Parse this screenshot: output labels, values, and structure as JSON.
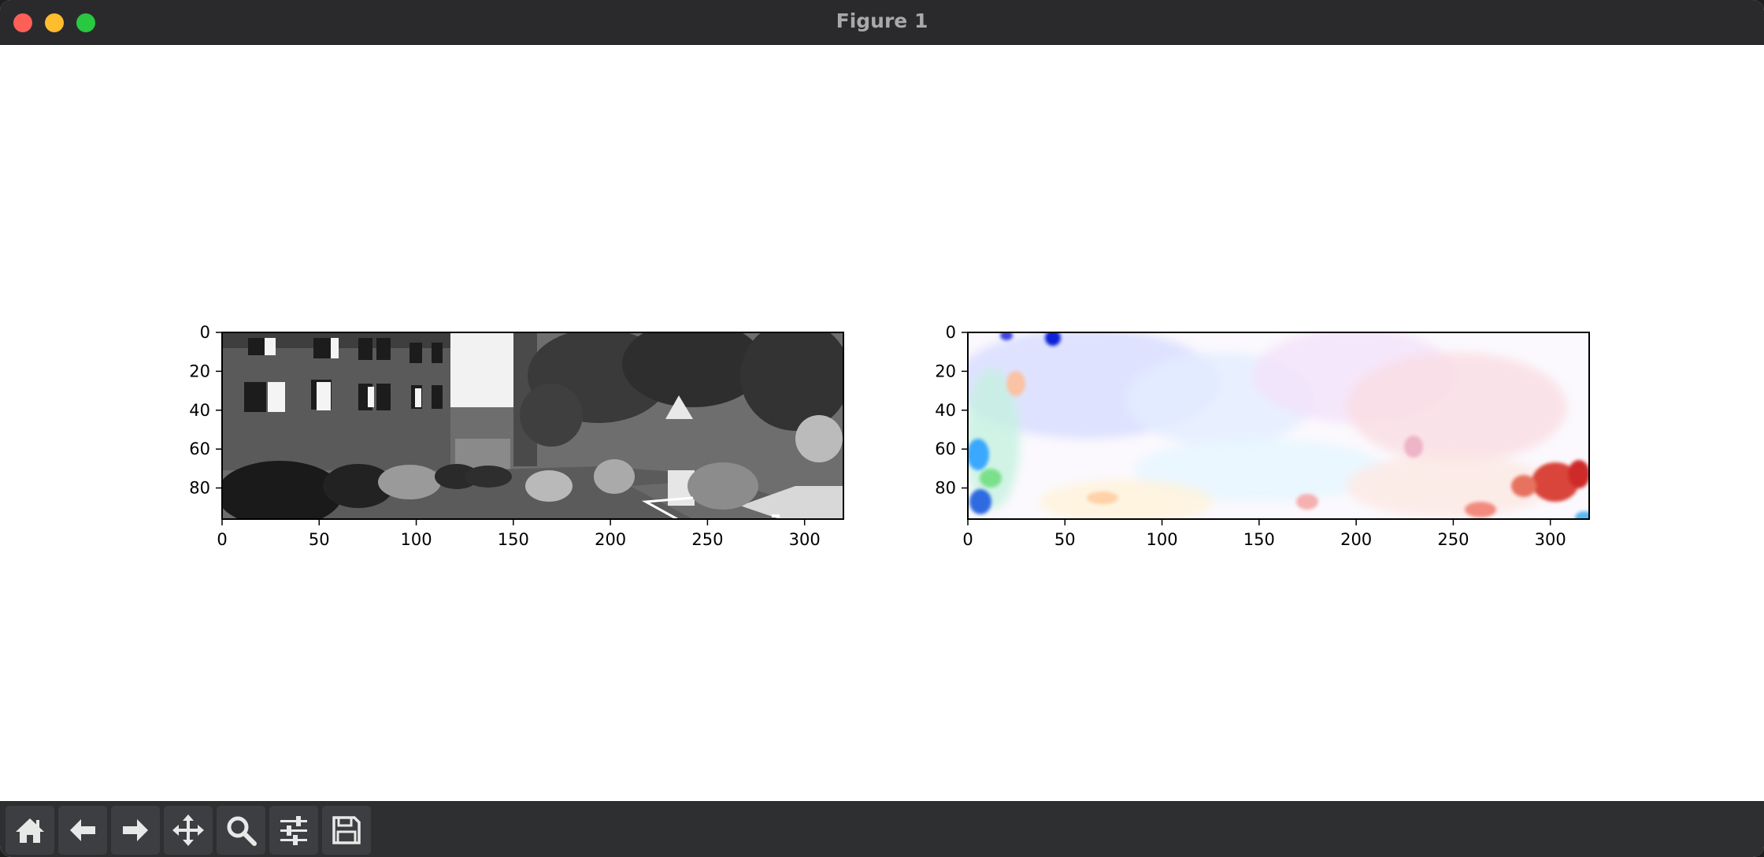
{
  "window": {
    "title": "Figure 1"
  },
  "toolbar": {
    "buttons": [
      {
        "name": "home-button",
        "icon": "home-icon"
      },
      {
        "name": "back-button",
        "icon": "arrow-left-icon"
      },
      {
        "name": "forward-button",
        "icon": "arrow-right-icon"
      },
      {
        "name": "pan-button",
        "icon": "move-icon"
      },
      {
        "name": "zoom-button",
        "icon": "magnifier-icon"
      },
      {
        "name": "configure-subplots-button",
        "icon": "sliders-icon"
      },
      {
        "name": "save-button",
        "icon": "floppy-disk-icon"
      }
    ]
  },
  "chart_data": [
    {
      "type": "heatmap",
      "content": "grayscale street scene photo",
      "xlim": [
        0,
        320
      ],
      "ylim": [
        96,
        0
      ],
      "xticks": [
        "0",
        "50",
        "100",
        "150",
        "200",
        "250",
        "300"
      ],
      "yticks": [
        "0",
        "20",
        "40",
        "60",
        "80"
      ]
    },
    {
      "type": "heatmap",
      "content": "optical flow color field",
      "xlim": [
        0,
        320
      ],
      "ylim": [
        96,
        0
      ],
      "xticks": [
        "0",
        "50",
        "100",
        "150",
        "200",
        "250",
        "300"
      ],
      "yticks": [
        "0",
        "20",
        "40",
        "60",
        "80"
      ]
    }
  ]
}
